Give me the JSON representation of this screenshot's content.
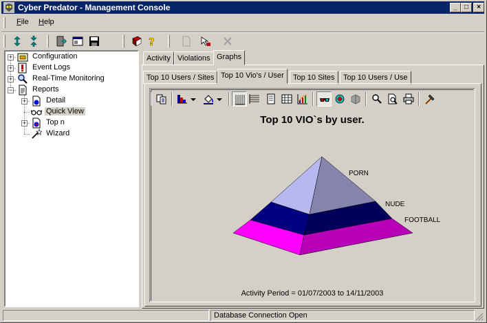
{
  "window": {
    "title": "Cyber Predator - Management Console"
  },
  "menu": [
    {
      "hotkey": "F",
      "rest": "ile"
    },
    {
      "hotkey": "H",
      "rest": "elp"
    }
  ],
  "tree": {
    "items": [
      {
        "label": "Configuration"
      },
      {
        "label": "Event Logs"
      },
      {
        "label": "Real-Time Monitoring"
      },
      {
        "label": "Reports"
      },
      {
        "label": "Detail"
      },
      {
        "label": "Quick View"
      },
      {
        "label": "Top n"
      },
      {
        "label": "Wizard"
      }
    ]
  },
  "main_tabs": [
    {
      "label": "Activity"
    },
    {
      "label": "Violations"
    },
    {
      "label": "Graphs"
    }
  ],
  "report_tabs": [
    {
      "label": "Top 10 Users / Sites"
    },
    {
      "label": "Top 10 Vio's / User"
    },
    {
      "label": "Top 10 Sites"
    },
    {
      "label": "Top 10 Users / Use"
    }
  ],
  "chart_data": {
    "type": "pyramid",
    "title": "Top 10 VIO`s by user.",
    "segments": [
      {
        "label": "PORN",
        "color": "#b8b8f0"
      },
      {
        "label": "NUDE",
        "color": "#000080"
      },
      {
        "label": "FOOTBALL",
        "color": "#ff00ff"
      }
    ],
    "footer": "Activity Period = 01/07/2003 to 14/11/2003"
  },
  "status": {
    "text": "Database Connection Open"
  }
}
